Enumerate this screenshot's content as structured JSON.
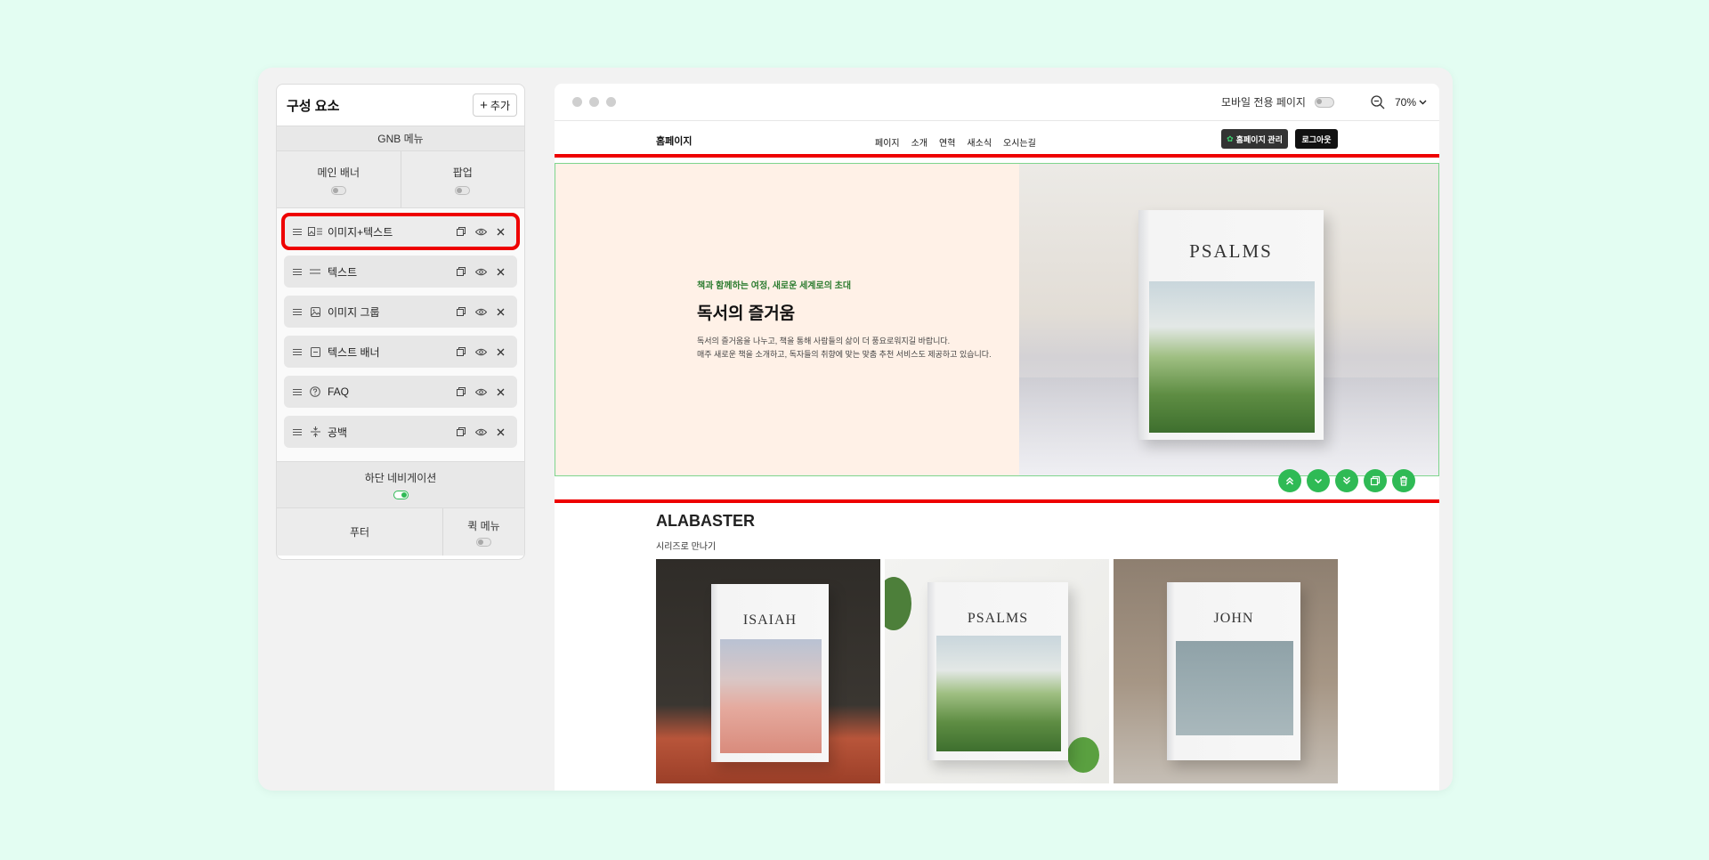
{
  "panel": {
    "title": "구성 요소",
    "add_label": "추가",
    "gnb_label": "GNB 메뉴",
    "top_split": [
      {
        "label": "메인 배너",
        "enabled": false
      },
      {
        "label": "팝업",
        "enabled": false
      }
    ],
    "components": [
      {
        "label": "이미지+텍스트",
        "icon": "image-text-icon",
        "selected": true
      },
      {
        "label": "텍스트",
        "icon": "text-lines-icon",
        "selected": false
      },
      {
        "label": "이미지 그룹",
        "icon": "image-icon",
        "selected": false
      },
      {
        "label": "텍스트 배너",
        "icon": "banner-icon",
        "selected": false
      },
      {
        "label": "FAQ",
        "icon": "question-circle-icon",
        "selected": false
      },
      {
        "label": "공백",
        "icon": "spacer-icon",
        "selected": false
      }
    ],
    "bottom_nav": {
      "label": "하단 네비게이션",
      "enabled": true
    },
    "footer": {
      "label": "푸터"
    },
    "quick_menu": {
      "label": "퀵 메뉴",
      "enabled": false
    }
  },
  "preview": {
    "mobile_only_label": "모바일 전용 페이지",
    "mobile_only_enabled": false,
    "zoom": "70%",
    "site": {
      "logo": "홈페이지",
      "nav": [
        "페이지",
        "소개",
        "연혁",
        "새소식",
        "오시는길"
      ],
      "admin_button": "홈페이지 관리",
      "logout_button": "로그아웃"
    },
    "hero": {
      "kicker": "책과 함께하는 여정, 새로운 세계로의 초대",
      "title": "독서의 즐거움",
      "desc_line1": "독서의 즐거움을 나누고, 책을 통해 사람들의 삶이 더 풍요로워지길 바랍니다.",
      "desc_line2": "매주 새로운 책을 소개하고, 독자들의 취향에 맞는 맞춤 추천 서비스도 제공하고 있습니다.",
      "book_title": "PSALMS"
    },
    "section2": {
      "title": "ALABASTER",
      "subtitle": "시리즈로 만나기",
      "books": [
        "ISAIAH",
        "PSALMS",
        "JOHN"
      ]
    }
  },
  "colors": {
    "accent_green": "#2fba55",
    "highlight_red": "#e00000",
    "page_bg": "#e3fdf2",
    "hero_bg": "#fff1e7"
  }
}
